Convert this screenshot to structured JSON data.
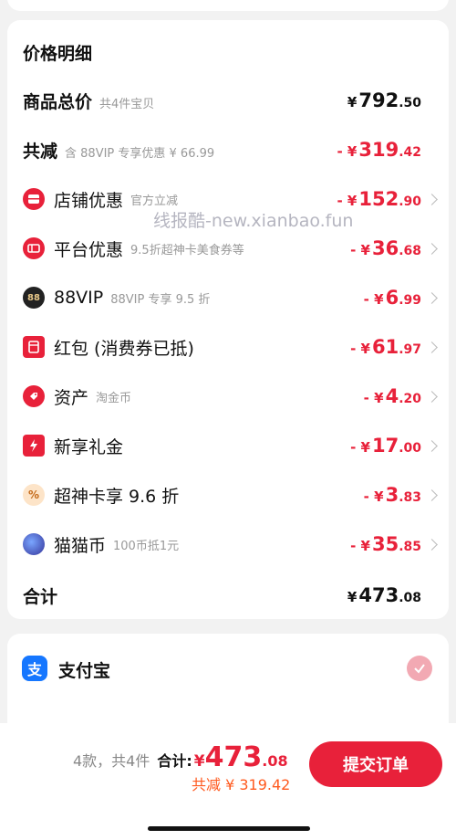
{
  "price_detail": {
    "title": "价格明细",
    "rows": [
      {
        "id": "goods-total",
        "label": "商品总价",
        "sub": "共4件宝贝",
        "prefix": "¥",
        "int": "792",
        "dec": ".50"
      },
      {
        "id": "total-reduce",
        "label": "共减",
        "sub": "含 88VIP 专享优惠 ¥ 66.99",
        "prefix": "- ¥",
        "int": "319",
        "dec": ".42"
      },
      {
        "id": "shop-discount",
        "label": "店铺优惠",
        "sub": "官方立减",
        "prefix": "- ¥",
        "int": "152",
        "dec": ".90",
        "icon": "shop-icon"
      },
      {
        "id": "platform-discount",
        "label": "平台优惠",
        "sub": "9.5折超神卡美食券等",
        "prefix": "- ¥",
        "int": "36",
        "dec": ".68",
        "icon": "ticket-icon"
      },
      {
        "id": "vip88",
        "label": "88VIP",
        "sub": "88VIP 专享 9.5 折",
        "prefix": "- ¥",
        "int": "6",
        "dec": ".99",
        "icon": "88vip-icon"
      },
      {
        "id": "red-packet",
        "label": "红包 (消费券已抵)",
        "sub": "",
        "prefix": "- ¥",
        "int": "61",
        "dec": ".97",
        "icon": "red-packet-icon"
      },
      {
        "id": "assets",
        "label": "资产",
        "sub": "淘金币",
        "prefix": "- ¥",
        "int": "4",
        "dec": ".20",
        "icon": "tag-icon"
      },
      {
        "id": "new-gift",
        "label": "新享礼金",
        "sub": "",
        "prefix": "- ¥",
        "int": "17",
        "dec": ".00",
        "icon": "lightning-icon"
      },
      {
        "id": "super-card",
        "label": "超神卡享 9.6 折",
        "sub": "",
        "prefix": "- ¥",
        "int": "3",
        "dec": ".83",
        "icon": "percent-icon"
      },
      {
        "id": "cat-coin",
        "label": "猫猫币",
        "sub": "100币抵1元",
        "prefix": "- ¥",
        "int": "35",
        "dec": ".85",
        "icon": "cat-coin-icon"
      },
      {
        "id": "grand-total",
        "label": "合计",
        "sub": "",
        "prefix": "¥",
        "int": "473",
        "dec": ".08"
      }
    ],
    "icon_text": {
      "vip88": "88",
      "percent": "%"
    },
    "watermark": "线报酷-new.xianbao.fun"
  },
  "payment": {
    "method": "支付宝",
    "icon_glyph": "支"
  },
  "bottom": {
    "count_text": "4款，共4件",
    "total_label": "合计:",
    "total_prefix": "¥",
    "total_int": "473",
    "total_dec": ".08",
    "saved_text": "共减 ¥ 319.42",
    "submit_label": "提交订单"
  },
  "colors": {
    "accent": "#e8213a",
    "saved": "#ff5a1f"
  }
}
